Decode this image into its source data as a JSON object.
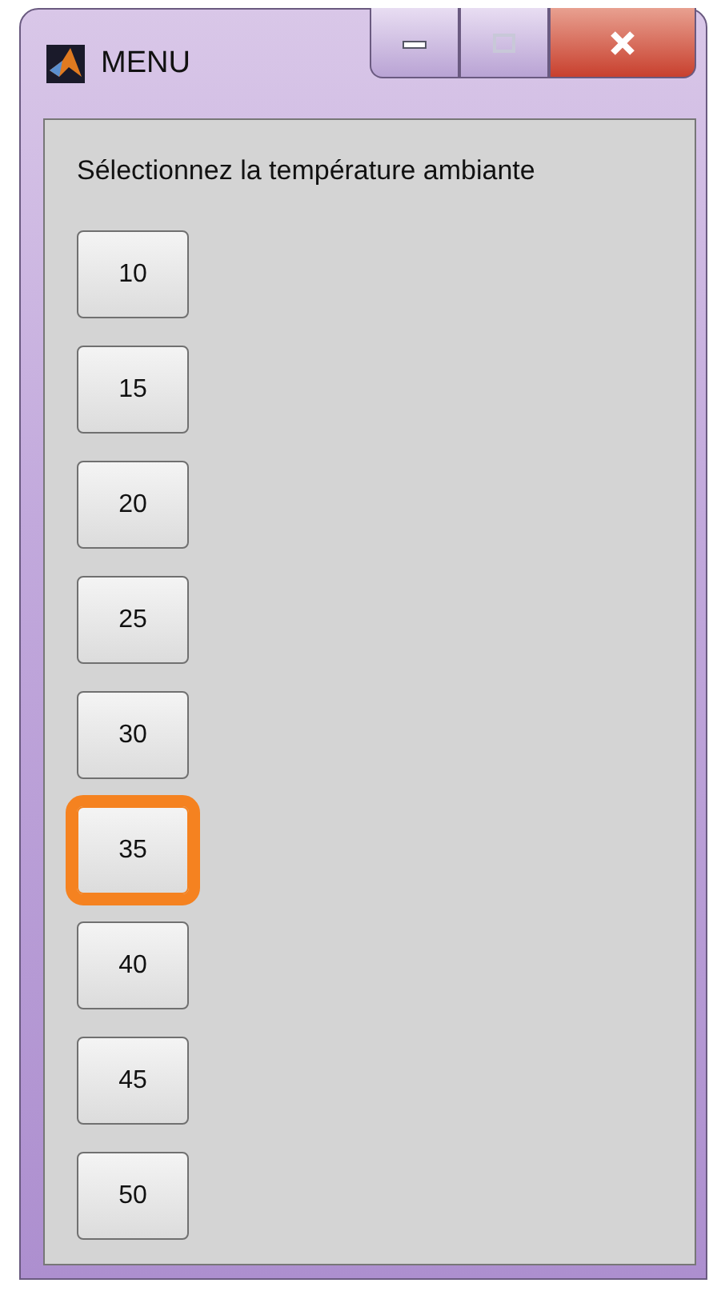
{
  "window": {
    "title": "MENU"
  },
  "prompt": "Sélectionnez la température ambiante",
  "buttons": [
    {
      "label": "10",
      "highlighted": false
    },
    {
      "label": "15",
      "highlighted": false
    },
    {
      "label": "20",
      "highlighted": false
    },
    {
      "label": "25",
      "highlighted": false
    },
    {
      "label": "30",
      "highlighted": false
    },
    {
      "label": "35",
      "highlighted": true
    },
    {
      "label": "40",
      "highlighted": false
    },
    {
      "label": "45",
      "highlighted": false
    },
    {
      "label": "50",
      "highlighted": false
    }
  ]
}
